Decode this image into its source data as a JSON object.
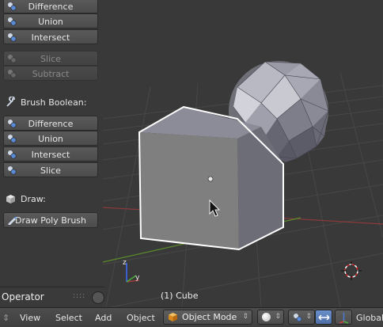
{
  "toolshelf": {
    "top_group": [
      "Difference",
      "Union",
      "Intersect"
    ],
    "disabled_group": [
      "Slice",
      "Subtract"
    ],
    "brush_boolean_label": "Brush Boolean:",
    "brush_group": [
      "Difference",
      "Union",
      "Intersect",
      "Slice"
    ],
    "draw_label": "Draw:",
    "draw_poly_brush": "Draw Poly Brush"
  },
  "operator_panel": {
    "title": "Operator",
    "handle": "::::"
  },
  "viewport": {
    "object_label": "(1) Cube",
    "axis_y": "y",
    "axis_z": "z"
  },
  "header": {
    "menus": [
      "View",
      "Select",
      "Add",
      "Object"
    ],
    "mode": "Object Mode",
    "orientation": "Global"
  },
  "colors": {
    "viewport_bg": "#393939",
    "grid_line": "#474747",
    "x_axis": "#8a3a3a",
    "y_axis": "#5a8a2a",
    "selection_outline": "#ffffff",
    "cube_face": "#8a8a8a"
  }
}
